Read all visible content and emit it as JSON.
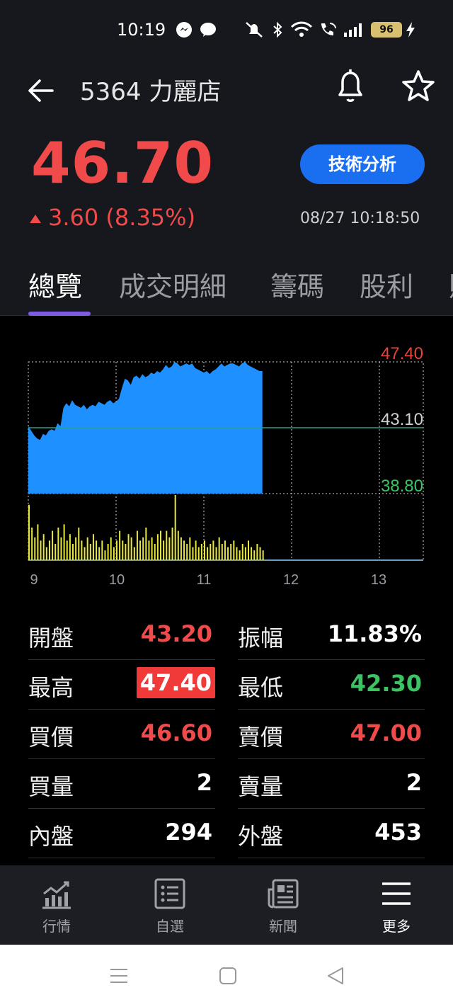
{
  "status_bar": {
    "time": "10:19",
    "battery": "96"
  },
  "header": {
    "title": "5364 力麗店"
  },
  "quote": {
    "price": "46.70",
    "change": "3.60 (8.35%)",
    "datetime": "08/27 10:18:50",
    "tech_button": "技術分析"
  },
  "tabs": [
    {
      "label": "總覽"
    },
    {
      "label": "成交明細"
    },
    {
      "label": "籌碼"
    },
    {
      "label": "股利"
    },
    {
      "label": "財"
    }
  ],
  "chart_data": {
    "type": "area",
    "y_labels": {
      "high": "47.40",
      "ref": "43.10",
      "low": "38.80"
    },
    "x_ticks": [
      "9",
      "10",
      "11",
      "12",
      "13"
    ],
    "ylim": [
      38.8,
      47.4
    ],
    "reference": 43.1,
    "x_range_minutes": [
      0,
      270
    ],
    "price_series": [
      [
        0,
        43.2
      ],
      [
        2,
        42.9
      ],
      [
        4,
        42.6
      ],
      [
        6,
        42.4
      ],
      [
        8,
        42.3
      ],
      [
        10,
        42.7
      ],
      [
        12,
        42.6
      ],
      [
        14,
        42.9
      ],
      [
        16,
        43.0
      ],
      [
        18,
        42.9
      ],
      [
        20,
        43.4
      ],
      [
        22,
        43.2
      ],
      [
        24,
        44.4
      ],
      [
        26,
        44.7
      ],
      [
        28,
        44.5
      ],
      [
        30,
        44.9
      ],
      [
        32,
        44.6
      ],
      [
        34,
        44.5
      ],
      [
        36,
        44.4
      ],
      [
        38,
        44.6
      ],
      [
        40,
        44.3
      ],
      [
        42,
        44.5
      ],
      [
        44,
        44.6
      ],
      [
        46,
        44.5
      ],
      [
        48,
        44.8
      ],
      [
        50,
        44.7
      ],
      [
        52,
        44.6
      ],
      [
        54,
        44.8
      ],
      [
        56,
        44.9
      ],
      [
        58,
        44.7
      ],
      [
        60,
        44.8
      ],
      [
        62,
        45.0
      ],
      [
        64,
        45.7
      ],
      [
        66,
        46.3
      ],
      [
        68,
        46.2
      ],
      [
        70,
        45.9
      ],
      [
        72,
        46.4
      ],
      [
        74,
        46.5
      ],
      [
        76,
        46.3
      ],
      [
        78,
        46.6
      ],
      [
        80,
        46.4
      ],
      [
        82,
        46.5
      ],
      [
        84,
        46.7
      ],
      [
        86,
        46.6
      ],
      [
        88,
        46.8
      ],
      [
        90,
        46.7
      ],
      [
        92,
        46.9
      ],
      [
        94,
        47.2
      ],
      [
        96,
        47.0
      ],
      [
        98,
        47.1
      ],
      [
        100,
        47.4
      ],
      [
        102,
        47.3
      ],
      [
        104,
        47.1
      ],
      [
        106,
        47.2
      ],
      [
        108,
        47.3
      ],
      [
        110,
        47.2
      ],
      [
        112,
        47.3
      ],
      [
        114,
        47.0
      ],
      [
        116,
        46.9
      ],
      [
        118,
        46.8
      ],
      [
        120,
        46.7
      ],
      [
        122,
        46.8
      ],
      [
        124,
        46.6
      ],
      [
        126,
        46.8
      ],
      [
        128,
        46.9
      ],
      [
        130,
        47.1
      ],
      [
        132,
        47.3
      ],
      [
        134,
        47.1
      ],
      [
        136,
        47.2
      ],
      [
        138,
        47.3
      ],
      [
        140,
        47.3
      ],
      [
        142,
        47.2
      ],
      [
        144,
        47.1
      ],
      [
        146,
        47.3
      ],
      [
        148,
        47.4
      ],
      [
        150,
        47.2
      ],
      [
        152,
        47.1
      ],
      [
        154,
        47.0
      ],
      [
        156,
        46.9
      ],
      [
        158,
        46.8
      ],
      [
        160,
        46.8
      ]
    ],
    "volume_series": [
      [
        0,
        0.85
      ],
      [
        2,
        0.5
      ],
      [
        4,
        0.35
      ],
      [
        6,
        0.55
      ],
      [
        8,
        0.3
      ],
      [
        10,
        0.4
      ],
      [
        12,
        0.2
      ],
      [
        14,
        0.3
      ],
      [
        16,
        0.45
      ],
      [
        18,
        0.25
      ],
      [
        20,
        0.5
      ],
      [
        22,
        0.35
      ],
      [
        24,
        0.55
      ],
      [
        26,
        0.3
      ],
      [
        28,
        0.4
      ],
      [
        30,
        0.25
      ],
      [
        32,
        0.35
      ],
      [
        34,
        0.5
      ],
      [
        36,
        0.3
      ],
      [
        38,
        0.2
      ],
      [
        40,
        0.35
      ],
      [
        42,
        0.25
      ],
      [
        44,
        0.4
      ],
      [
        46,
        0.3
      ],
      [
        48,
        0.2
      ],
      [
        50,
        0.3
      ],
      [
        52,
        0.15
      ],
      [
        54,
        0.25
      ],
      [
        56,
        0.35
      ],
      [
        58,
        0.2
      ],
      [
        60,
        0.3
      ],
      [
        62,
        0.45
      ],
      [
        64,
        0.3
      ],
      [
        66,
        0.25
      ],
      [
        68,
        0.4
      ],
      [
        70,
        0.35
      ],
      [
        72,
        0.2
      ],
      [
        74,
        0.45
      ],
      [
        76,
        0.3
      ],
      [
        78,
        0.35
      ],
      [
        80,
        0.5
      ],
      [
        82,
        0.3
      ],
      [
        84,
        0.35
      ],
      [
        86,
        0.25
      ],
      [
        88,
        0.4
      ],
      [
        90,
        0.45
      ],
      [
        92,
        0.3
      ],
      [
        94,
        0.45
      ],
      [
        96,
        0.35
      ],
      [
        98,
        0.5
      ],
      [
        100,
        1.0
      ],
      [
        102,
        0.45
      ],
      [
        104,
        0.35
      ],
      [
        106,
        0.3
      ],
      [
        108,
        0.25
      ],
      [
        110,
        0.35
      ],
      [
        112,
        0.2
      ],
      [
        114,
        0.3
      ],
      [
        116,
        0.2
      ],
      [
        118,
        0.25
      ],
      [
        120,
        0.3
      ],
      [
        122,
        0.2
      ],
      [
        124,
        0.25
      ],
      [
        126,
        0.3
      ],
      [
        128,
        0.2
      ],
      [
        130,
        0.35
      ],
      [
        132,
        0.25
      ],
      [
        134,
        0.3
      ],
      [
        136,
        0.2
      ],
      [
        138,
        0.25
      ],
      [
        140,
        0.3
      ],
      [
        142,
        0.2
      ],
      [
        144,
        0.15
      ],
      [
        146,
        0.25
      ],
      [
        148,
        0.2
      ],
      [
        150,
        0.3
      ],
      [
        152,
        0.2
      ],
      [
        154,
        0.15
      ],
      [
        156,
        0.25
      ],
      [
        158,
        0.2
      ],
      [
        160,
        0.15
      ]
    ]
  },
  "quote_table": {
    "left": [
      {
        "label": "開盤",
        "value": "43.20",
        "style": "red"
      },
      {
        "label": "最高",
        "value": "47.40",
        "style": "hl"
      },
      {
        "label": "買價",
        "value": "46.60",
        "style": "red"
      },
      {
        "label": "買量",
        "value": "2",
        "style": "white"
      },
      {
        "label": "內盤",
        "value": "294",
        "style": "white"
      }
    ],
    "right": [
      {
        "label": "振幅",
        "value": "11.83%",
        "style": "white"
      },
      {
        "label": "最低",
        "value": "42.30",
        "style": "green"
      },
      {
        "label": "賣價",
        "value": "47.00",
        "style": "red"
      },
      {
        "label": "賣量",
        "value": "2",
        "style": "white"
      },
      {
        "label": "外盤",
        "value": "453",
        "style": "white"
      }
    ]
  },
  "bottom_nav": [
    {
      "label": "行情",
      "icon": "market-chart-icon"
    },
    {
      "label": "自選",
      "icon": "watchlist-icon"
    },
    {
      "label": "新聞",
      "icon": "news-icon"
    },
    {
      "label": "更多",
      "icon": "menu-icon"
    }
  ],
  "colors": {
    "up": "#f04a4a",
    "down": "#3cc464",
    "accent": "#1a6ef0",
    "chart_fill": "#1e90ff",
    "volume": "#e8e83a",
    "tab_indicator": "#7c5ce0"
  }
}
